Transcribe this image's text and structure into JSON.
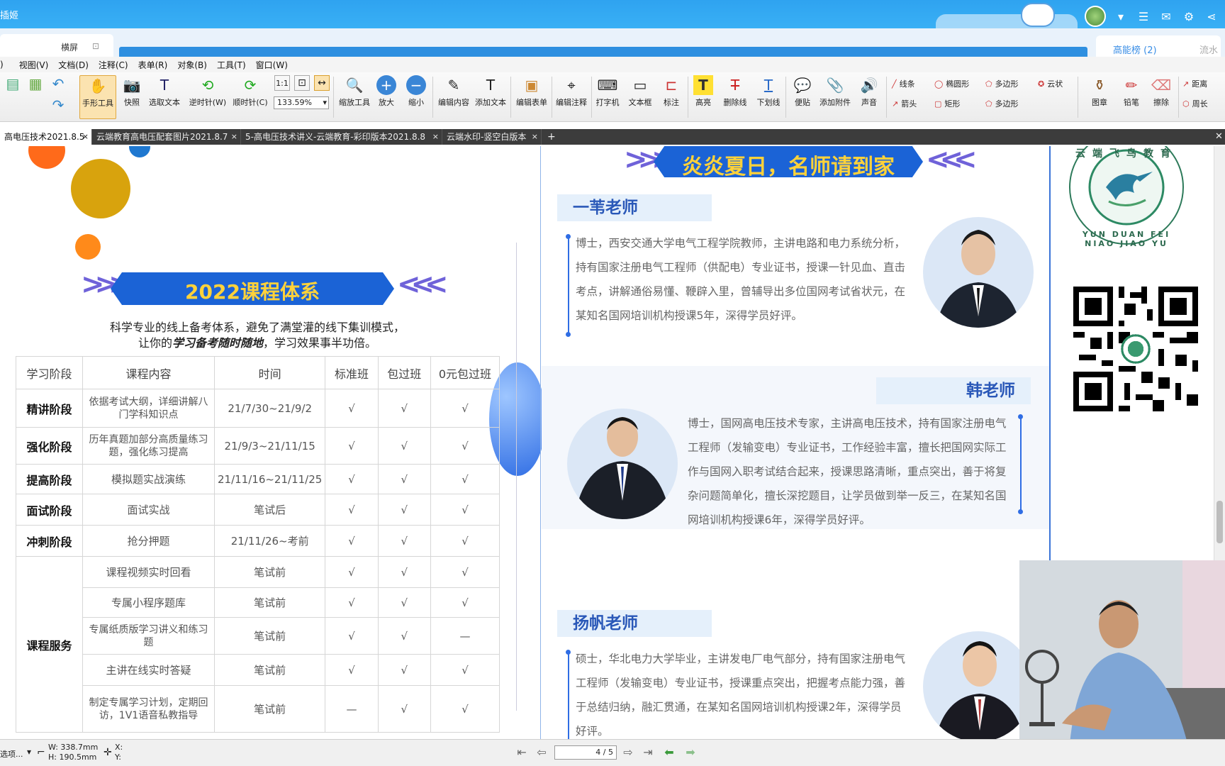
{
  "titlebar": {
    "app_title": "插姬"
  },
  "window_tabs": {
    "active_label": "横屏",
    "right_tab_label": "高能榜 (2)",
    "right_tab_extra": "流水流"
  },
  "menu": [
    ")",
    "视图(V)",
    "文档(D)",
    "注释(C)",
    "表单(R)",
    "对象(B)",
    "工具(T)",
    "窗口(W)"
  ],
  "toolbar": {
    "tools": [
      {
        "label": "手形工具",
        "icon": "hand-icon"
      },
      {
        "label": "快照",
        "icon": "camera-icon"
      },
      {
        "label": "选取文本",
        "icon": "select-text-icon"
      },
      {
        "label": "逆时针(W)",
        "icon": "rotate-ccw-icon"
      },
      {
        "label": "顺时针(C)",
        "icon": "rotate-cw-icon"
      },
      {
        "label": "缩放工具",
        "icon": "zoom-tool-icon"
      },
      {
        "label": "放大",
        "icon": "zoom-in-icon"
      },
      {
        "label": "缩小",
        "icon": "zoom-out-icon"
      },
      {
        "label": "编辑内容",
        "icon": "edit-content-icon"
      },
      {
        "label": "添加文本",
        "icon": "add-text-icon"
      },
      {
        "label": "编辑表单",
        "icon": "edit-form-icon"
      },
      {
        "label": "编辑注释",
        "icon": "edit-annotation-icon"
      },
      {
        "label": "打字机",
        "icon": "typewriter-icon"
      },
      {
        "label": "文本框",
        "icon": "textbox-icon"
      },
      {
        "label": "标注",
        "icon": "callout-icon"
      },
      {
        "label": "高亮",
        "icon": "highlight-icon"
      },
      {
        "label": "删除线",
        "icon": "strikeout-icon"
      },
      {
        "label": "下划线",
        "icon": "underline-icon"
      },
      {
        "label": "便贴",
        "icon": "note-icon"
      },
      {
        "label": "添加附件",
        "icon": "attachment-icon"
      },
      {
        "label": "声音",
        "icon": "sound-icon"
      },
      {
        "label": "图章",
        "icon": "stamp-icon"
      },
      {
        "label": "铅笔",
        "icon": "pencil-icon"
      },
      {
        "label": "擦除",
        "icon": "eraser-icon"
      }
    ],
    "zoom_value": "133.59%",
    "shapes": [
      "线条",
      "椭圆形",
      "多边形",
      "云状",
      "箭头",
      "矩形",
      "多边形"
    ],
    "measure": [
      "距离",
      "周长"
    ]
  },
  "doc_tabs": [
    "高电压技术2021.8.5",
    "云端教育高电压配套图片2021.8.7",
    "5-高电压技术讲义-云端教育-彩印版本2021.8.8",
    "云端水印-竖空白版本"
  ],
  "left_page": {
    "banner": "2022课程体系",
    "intro1": "科学专业的线上备考体系，避免了满堂灌的线下集训模式，",
    "intro2_prefix": "让你的",
    "intro2_bold": "学习备考随时随地",
    "intro2_suffix": "，学习效果事半功倍。",
    "headers": [
      "学习阶段",
      "课程内容",
      "时间",
      "标准班",
      "包过班",
      "0元包过班"
    ],
    "rows": [
      {
        "stage": "精讲阶段",
        "content": "依据考试大纲，详细讲解八门学科知识点",
        "time": "21/7/30~21/9/2",
        "a": "√",
        "b": "√",
        "c": "√"
      },
      {
        "stage": "强化阶段",
        "content": "历年真题加部分高质量练习题，强化练习提高",
        "time": "21/9/3~21/11/15",
        "a": "√",
        "b": "√",
        "c": "√"
      },
      {
        "stage": "提高阶段",
        "content": "模拟题实战演练",
        "time": "21/11/16~21/11/25",
        "a": "√",
        "b": "√",
        "c": "√"
      },
      {
        "stage": "面试阶段",
        "content": "面试实战",
        "time": "笔试后",
        "a": "√",
        "b": "√",
        "c": "√"
      },
      {
        "stage": "冲刺阶段",
        "content": "抢分押题",
        "time": "21/11/26~考前",
        "a": "√",
        "b": "√",
        "c": "√"
      }
    ],
    "service_stage": "课程服务",
    "service_rows": [
      {
        "content": "课程视频实时回看",
        "time": "笔试前",
        "a": "√",
        "b": "√",
        "c": "√"
      },
      {
        "content": "专属小程序题库",
        "time": "笔试前",
        "a": "√",
        "b": "√",
        "c": "√"
      },
      {
        "content": "专属纸质版学习讲义和练习题",
        "time": "笔试前",
        "a": "√",
        "b": "√",
        "c": "—"
      },
      {
        "content": "主讲在线实时答疑",
        "time": "笔试前",
        "a": "√",
        "b": "√",
        "c": "√"
      },
      {
        "content": "制定专属学习计划，定期回访，1V1语音私教指导",
        "time": "笔试前",
        "a": "—",
        "b": "√",
        "c": "√"
      }
    ]
  },
  "right_page": {
    "banner": "炎炎夏日，名师请到家",
    "teachers": [
      {
        "name": "一苇老师",
        "bio": "博士，西安交通大学电气工程学院教师，主讲电路和电力系统分析，持有国家注册电气工程师（供配电）专业证书，授课一针见血、直击考点，讲解通俗易懂、鞭辟入里，曾辅导出多位国网考试省状元，在某知名国网培训机构授课5年，深得学员好评。"
      },
      {
        "name": "韩老师",
        "bio": "博士，国网高电压技术专家，主讲高电压技术，持有国家注册电气工程师（发输变电）专业证书，工作经验丰富，擅长把国网实际工作与国网入职考试结合起来，授课思路清晰，重点突出，善于将复杂问题简单化，擅长深挖题目，让学员做到举一反三，在某知名国网培训机构授课6年，深得学员好评。"
      },
      {
        "name": "扬帆老师",
        "bio": "硕士，华北电力大学毕业，主讲发电厂电气部分，持有国家注册电气工程师（发输变电）专业证书，授课重点突出，把握考点能力强，善于总结归纳，融汇贯通，在某知名国网培训机构授课2年，深得学员好评。"
      }
    ],
    "seal_text": "YUN DUAN FEI NIAO JIAO YU",
    "seal_top": "云端飞鸟教育"
  },
  "statusbar": {
    "left": "选项...",
    "width": "W: 338.7mm",
    "height": "H: 190.5mm",
    "x": "X:",
    "y": "Y:",
    "page": "4",
    "total": "5"
  }
}
